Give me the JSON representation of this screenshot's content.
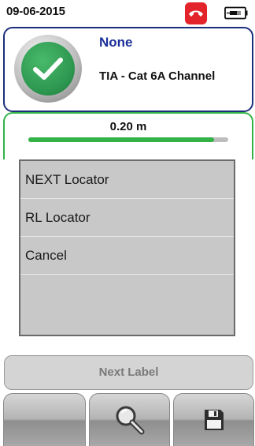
{
  "status_bar": {
    "date": "09-06-2015",
    "phone_icon": "phone-hangup-icon",
    "battery_icon": "battery-plug-icon",
    "phone_color": "#e3242b"
  },
  "result": {
    "status_icon": "check-icon",
    "title": "None",
    "subtitle": "TIA - Cat 6A Channel",
    "accent_color": "#1c2f9a",
    "pass_color": "#2f9a52"
  },
  "length": {
    "value_label": "0.20 m",
    "fill_fraction": 0.93,
    "bar_color": "#33b347"
  },
  "menu": {
    "items": [
      {
        "label": "NEXT Locator"
      },
      {
        "label": "RL Locator"
      },
      {
        "label": "Cancel"
      }
    ]
  },
  "next_label": {
    "label": "Next Label"
  },
  "bottom_bar": {
    "buttons": [
      {
        "icon": "blank"
      },
      {
        "icon": "magnifier-icon"
      },
      {
        "icon": "save-icon"
      }
    ]
  }
}
